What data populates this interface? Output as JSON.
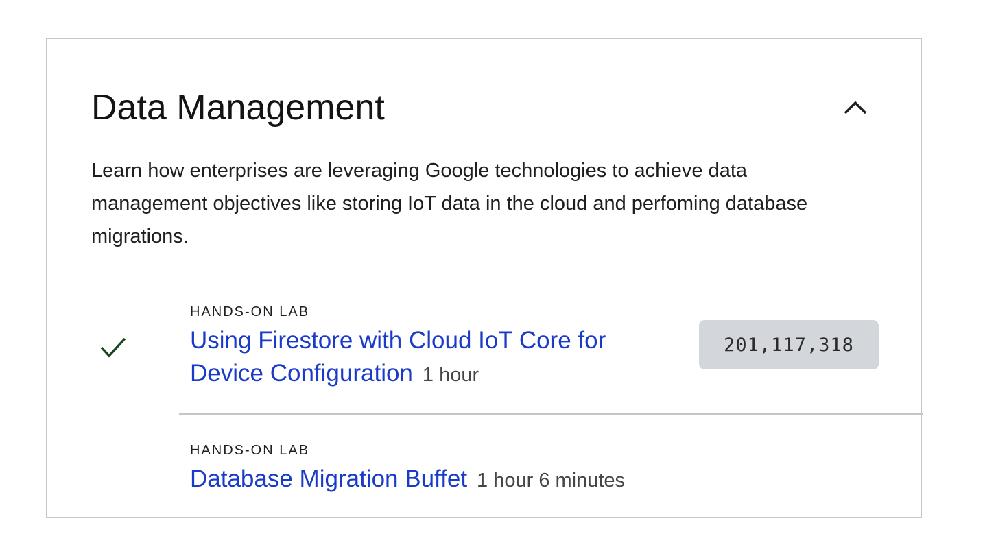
{
  "section": {
    "title": "Data Management",
    "description": "Learn how enterprises are leveraging Google technologies to achieve data management objectives like storing IoT data in the cloud and perfoming database migrations.",
    "collapse_icon": "chevron-up-icon"
  },
  "labs": [
    {
      "kind": "HANDS-ON LAB",
      "title": "Using Firestore with Cloud IoT Core for Device Configuration",
      "duration": "1 hour",
      "completed": true,
      "count": "201,117,318"
    },
    {
      "kind": "HANDS-ON LAB",
      "title": "Database Migration Buffet",
      "duration": "1 hour 6 minutes",
      "completed": false
    }
  ],
  "colors": {
    "link": "#1a3bc8",
    "check": "#1e4620",
    "badge_bg": "#d3d6da",
    "border": "#c4c7c9"
  }
}
